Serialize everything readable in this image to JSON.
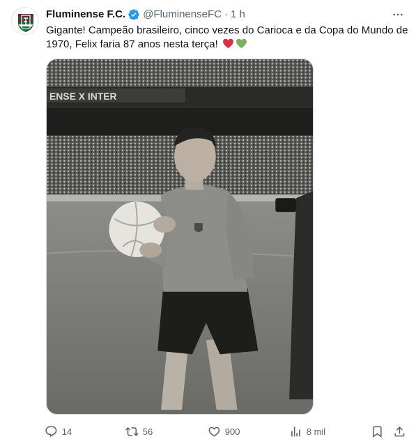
{
  "account": {
    "display_name": "Fluminense F.C.",
    "handle": "@FluminenseFC",
    "separator": "·",
    "time": "1 h",
    "verified": true
  },
  "tweet": {
    "text": "Gigante! Campeão brasileiro, cinco vezes do Carioca e da Copa do Mundo de 1970, Felix faria 87 anos nesta terça!",
    "emojis": [
      "red-heart",
      "green-heart"
    ]
  },
  "media": {
    "scoreboard_text": "ENSE X INTER"
  },
  "actions": {
    "replies": "14",
    "reposts": "56",
    "likes": "900",
    "views": "8 mil"
  },
  "colors": {
    "text": "#0f1419",
    "secondary": "#536471",
    "verified": "#1d9bf0",
    "club_maroon": "#7b1c34",
    "club_green": "#0f6b3b"
  }
}
